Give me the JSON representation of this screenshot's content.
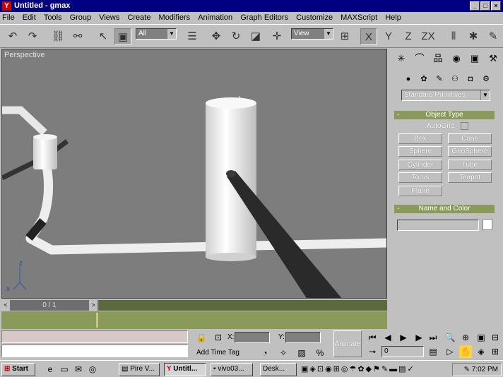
{
  "window": {
    "title": "Untitled - gmax"
  },
  "menu": [
    "File",
    "Edit",
    "Tools",
    "Group",
    "Views",
    "Create",
    "Modifiers",
    "Animation",
    "Graph Editors",
    "Customize",
    "MAXScript",
    "Help"
  ],
  "toolbar": {
    "selection_filter": "All",
    "ref_coord": "View",
    "axis_x": "X",
    "axis_y": "Y",
    "axis_z": "Z",
    "axis_zx": "ZX"
  },
  "viewport": {
    "label": "Perspective",
    "axis_z": "z",
    "axis_x": "x"
  },
  "command_panel": {
    "category_dropdown": "Standard Primitives",
    "object_type_title": "Object Type",
    "autogrid_label": "AutoGrid",
    "buttons": [
      "Box",
      "Cone",
      "Sphere",
      "GeoSphere",
      "Cylinder",
      "Tube",
      "Torus",
      "Teapot",
      "Plane"
    ],
    "name_color_title": "Name and Color"
  },
  "time_slider": {
    "label": "0 / 1"
  },
  "status": {
    "x_label": "X:",
    "y_label": "Y:",
    "add_time_tag": "Add Time Tag",
    "animate": "Animate",
    "frame": "0"
  },
  "taskbar": {
    "start": "Start",
    "tasks": [
      "Pire V...",
      "Untitl...",
      "vivo03...",
      "Desk..."
    ],
    "clock": "7:02 PM"
  },
  "colors": {
    "title_bg": "#000080",
    "viewport_bg": "#7d7d7d",
    "trackbar": "#8a9a5b"
  }
}
